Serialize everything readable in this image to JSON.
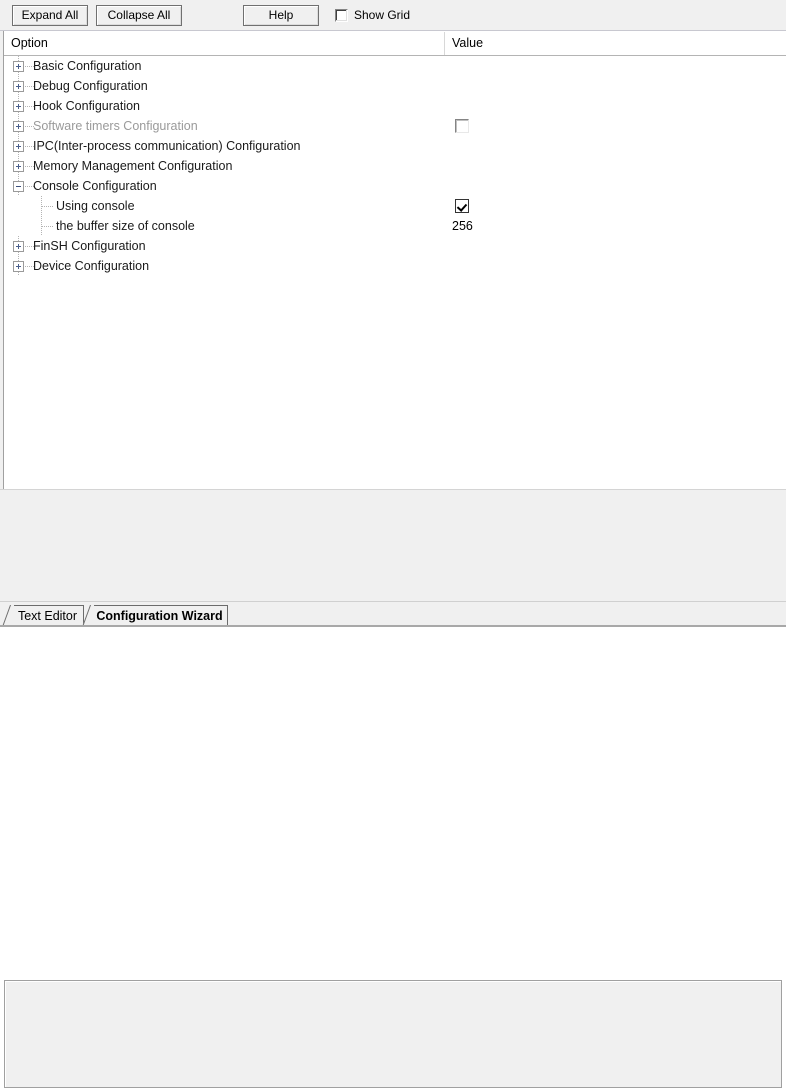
{
  "toolbar": {
    "expand_all_label": "Expand All",
    "collapse_all_label": "Collapse All",
    "help_label": "Help",
    "show_grid_label": "Show Grid",
    "show_grid_checked": false
  },
  "columns": {
    "option_header": "Option",
    "value_header": "Value"
  },
  "tree": {
    "rows": [
      {
        "label": "Basic Configuration",
        "level": 0,
        "expander": "plus",
        "disabled": false,
        "value_type": "none",
        "value": ""
      },
      {
        "label": "Debug Configuration",
        "level": 0,
        "expander": "plus",
        "disabled": false,
        "value_type": "none",
        "value": ""
      },
      {
        "label": "Hook Configuration",
        "level": 0,
        "expander": "plus",
        "disabled": false,
        "value_type": "none",
        "value": ""
      },
      {
        "label": "Software timers Configuration",
        "level": 0,
        "expander": "plus",
        "disabled": true,
        "value_type": "checkbox-off",
        "value": ""
      },
      {
        "label": "IPC(Inter-process communication) Configuration",
        "level": 0,
        "expander": "plus",
        "disabled": false,
        "value_type": "none",
        "value": ""
      },
      {
        "label": "Memory Management Configuration",
        "level": 0,
        "expander": "plus",
        "disabled": false,
        "value_type": "none",
        "value": ""
      },
      {
        "label": "Console Configuration",
        "level": 0,
        "expander": "minus",
        "disabled": false,
        "value_type": "none",
        "value": ""
      },
      {
        "label": "Using console",
        "level": 1,
        "expander": "none",
        "disabled": false,
        "value_type": "checkbox-on",
        "value": ""
      },
      {
        "label": "the buffer size of console",
        "level": 1,
        "expander": "none",
        "disabled": false,
        "value_type": "text",
        "value": "256"
      },
      {
        "label": "FinSH Configuration",
        "level": 0,
        "expander": "plus",
        "disabled": false,
        "value_type": "none",
        "value": ""
      },
      {
        "label": "Device Configuration",
        "level": 0,
        "expander": "plus",
        "disabled": false,
        "value_type": "none",
        "value": ""
      }
    ]
  },
  "description_pane": {
    "text": ""
  },
  "tabs": [
    {
      "label": "Text Editor",
      "active": false
    },
    {
      "label": "Configuration Wizard",
      "active": true
    }
  ],
  "colors": {
    "toolbar_background": "#f0f0f0",
    "tree_background": "#ffffff",
    "disabled_text": "#9a9a9a",
    "expander_glyph": "#4a5f8c",
    "border": "#a0a0a0"
  }
}
